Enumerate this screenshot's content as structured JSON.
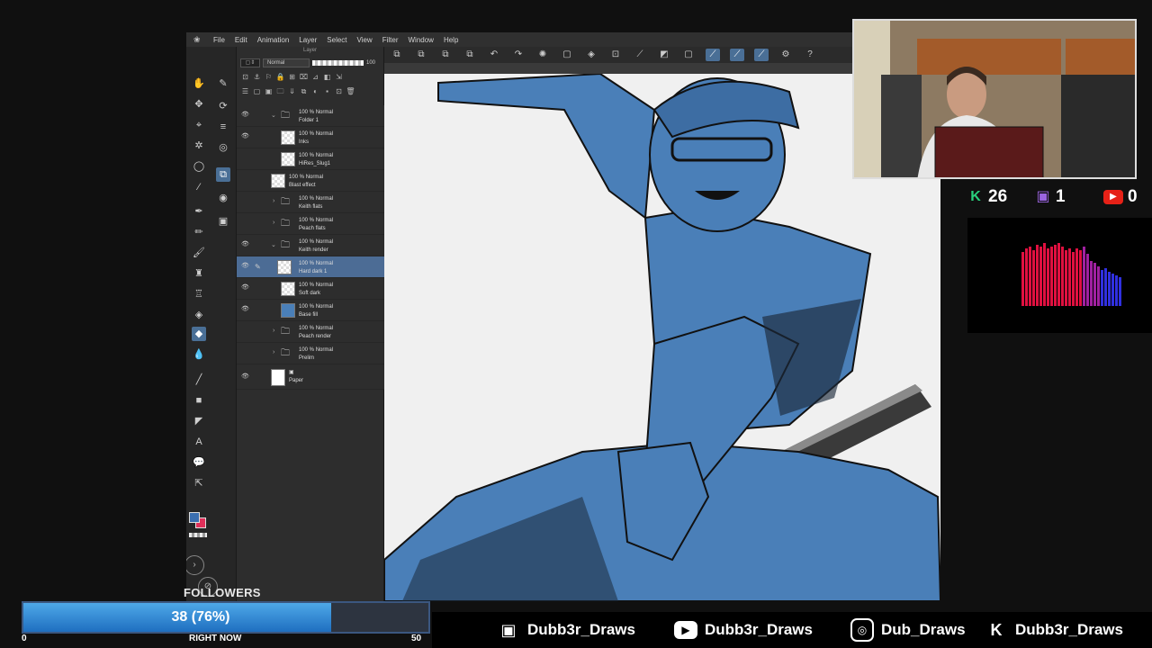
{
  "app": {
    "menus": [
      "File",
      "Edit",
      "Animation",
      "Layer",
      "Select",
      "View",
      "Filter",
      "Window",
      "Help"
    ],
    "layer_panel": {
      "title": "Layer",
      "blend_mode": "Normal",
      "opacity": "100",
      "layers": [
        {
          "opacity": "100 %",
          "mode": "Normal",
          "name": "Folder 1",
          "type": "folder",
          "visible": true,
          "expanded": true
        },
        {
          "opacity": "100 %",
          "mode": "Normal",
          "name": "Inks",
          "type": "raster",
          "visible": true
        },
        {
          "opacity": "100 %",
          "mode": "Normal",
          "name": "HiRes_Slug1",
          "type": "raster",
          "visible": false
        },
        {
          "opacity": "100 %",
          "mode": "Normal",
          "name": "Blast effect",
          "type": "raster",
          "visible": false
        },
        {
          "opacity": "100 %",
          "mode": "Normal",
          "name": "Keith flats",
          "type": "folder",
          "visible": false
        },
        {
          "opacity": "100 %",
          "mode": "Normal",
          "name": "Peach flats",
          "type": "folder",
          "visible": false
        },
        {
          "opacity": "100 %",
          "mode": "Normal",
          "name": "Keith render",
          "type": "folder",
          "visible": true,
          "expanded": true
        },
        {
          "opacity": "100 %",
          "mode": "Normal",
          "name": "Hard dark 1",
          "type": "raster",
          "visible": true,
          "selected": true
        },
        {
          "opacity": "100 %",
          "mode": "Normal",
          "name": "Soft dark",
          "type": "raster",
          "visible": true
        },
        {
          "opacity": "100 %",
          "mode": "Normal",
          "name": "Base fill",
          "type": "raster",
          "visible": true
        },
        {
          "opacity": "100 %",
          "mode": "Normal",
          "name": "Peach render",
          "type": "folder",
          "visible": false
        },
        {
          "opacity": "100 %",
          "mode": "Normal",
          "name": "Prelim",
          "type": "folder",
          "visible": false
        },
        {
          "opacity": "",
          "mode": "",
          "name": "Paper",
          "type": "paper",
          "visible": true
        }
      ]
    },
    "colors": {
      "main": "#3b6fb0",
      "sub": "#e0305a",
      "artwork_blue": "#4a7fb8"
    }
  },
  "stream": {
    "stats": {
      "kofi": "26",
      "twitch": "1",
      "youtube": "0"
    },
    "goal": {
      "title": "FOLLOWERS",
      "text": "38 (76%)",
      "progress": 0.76,
      "min": "0",
      "center": "RIGHT NOW",
      "max": "50"
    },
    "socials": [
      {
        "icon": "twitch-icon",
        "handle": "Dubb3r_Draws"
      },
      {
        "icon": "youtube-icon",
        "handle": "Dubb3r_Draws"
      },
      {
        "icon": "instagram-icon",
        "handle": "Dub_Draws"
      },
      {
        "icon": "kofi-icon",
        "handle": "Dubb3r_Draws"
      }
    ]
  }
}
